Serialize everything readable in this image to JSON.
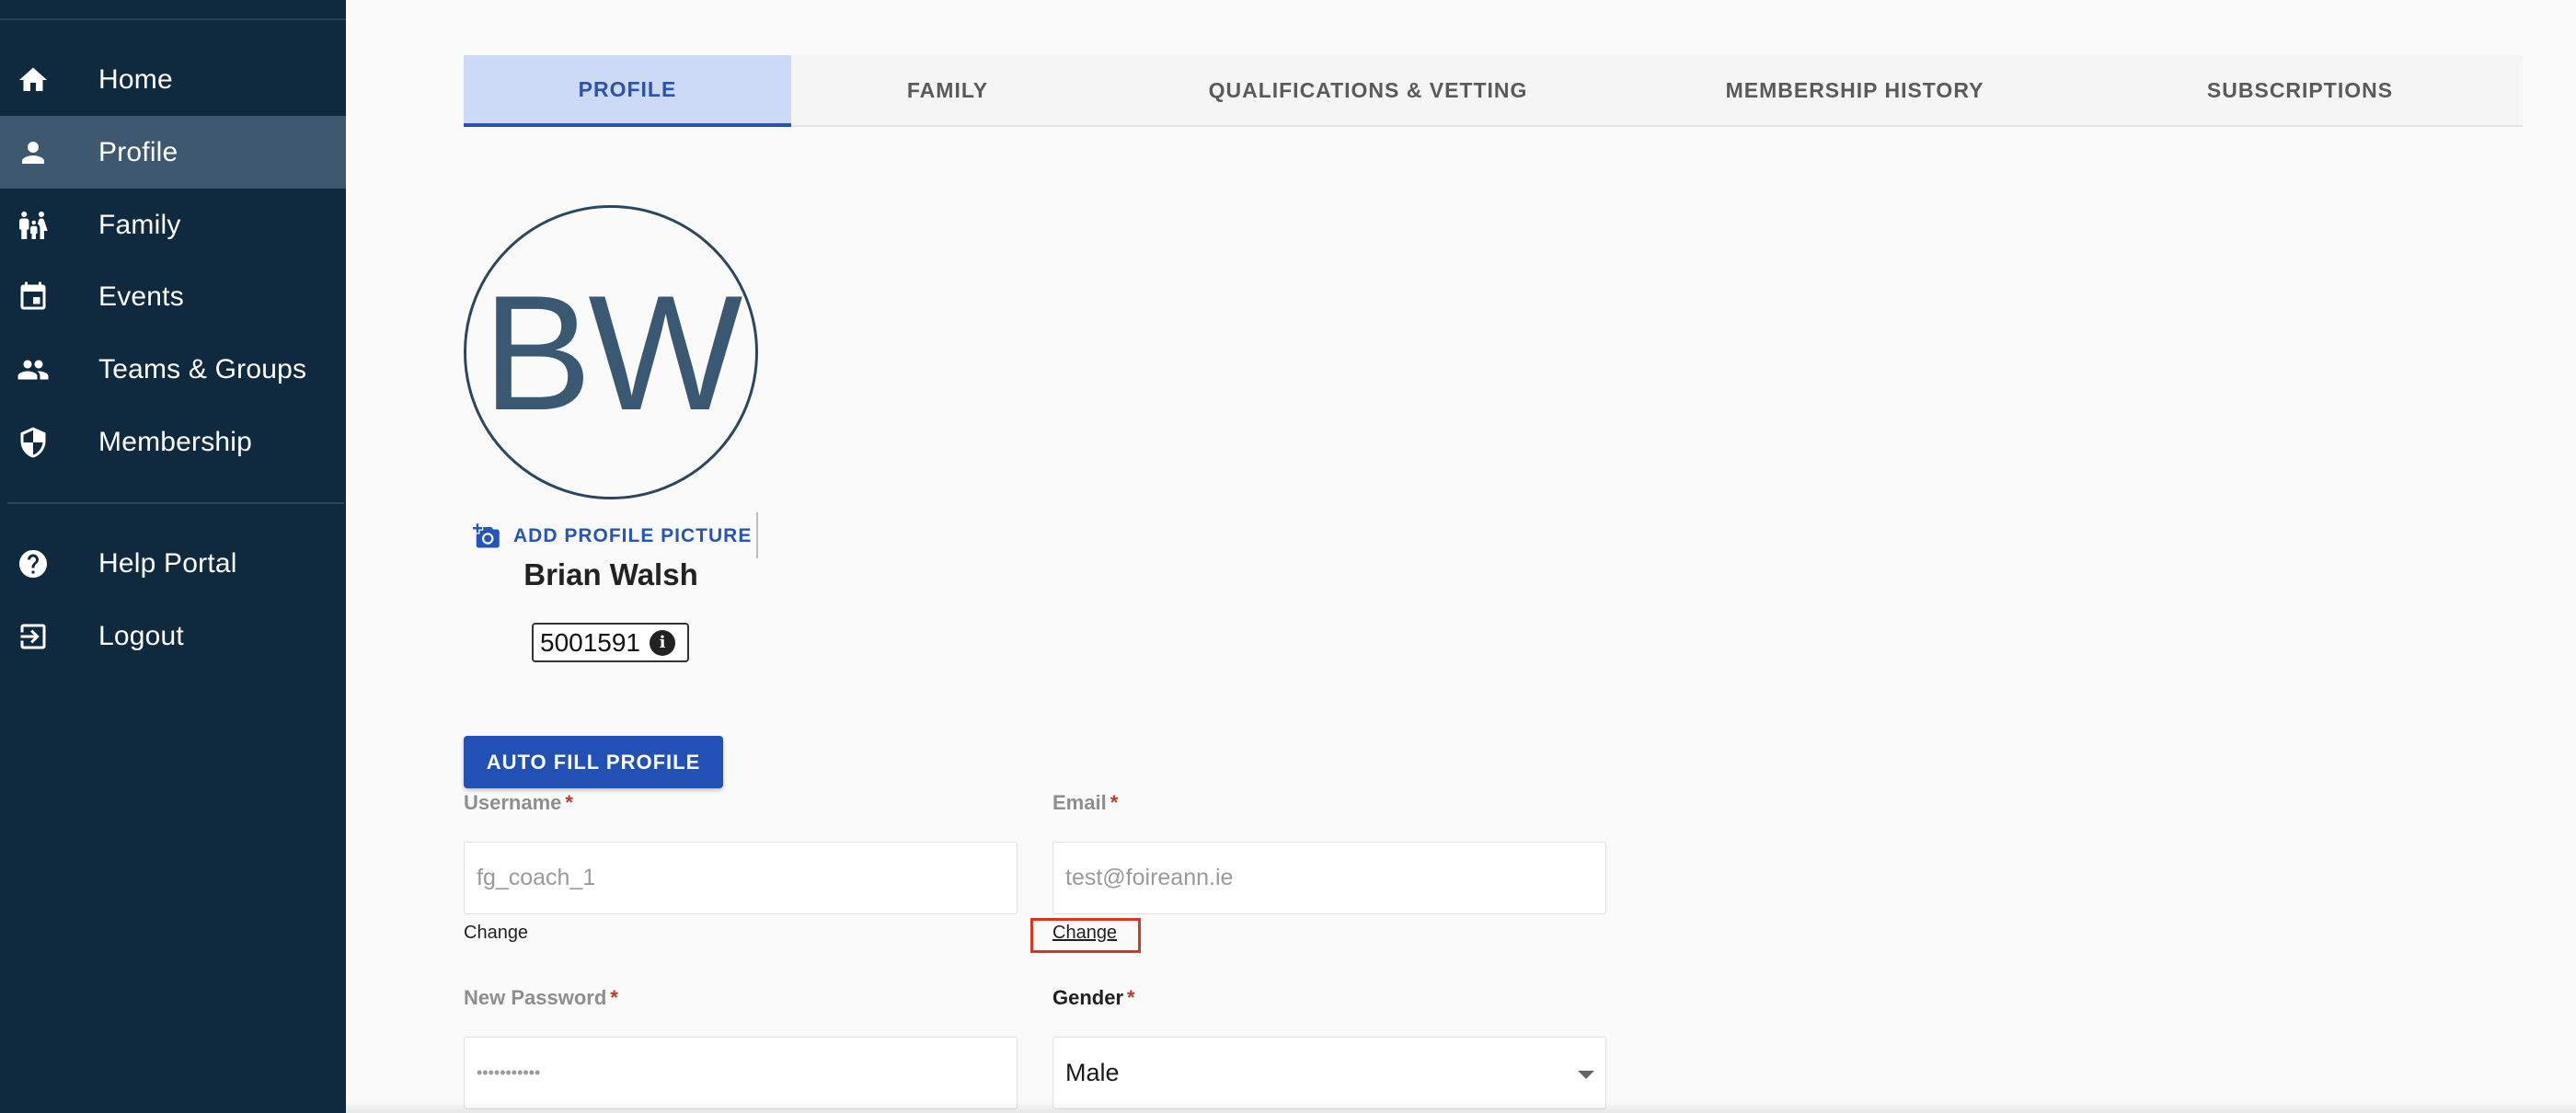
{
  "sidebar": {
    "items": [
      {
        "label": "Home",
        "icon": "home-icon"
      },
      {
        "label": "Profile",
        "icon": "person-icon",
        "active": true
      },
      {
        "label": "Family",
        "icon": "family-icon"
      },
      {
        "label": "Events",
        "icon": "calendar-icon"
      },
      {
        "label": "Teams & Groups",
        "icon": "group-icon"
      },
      {
        "label": "Membership",
        "icon": "shield-icon"
      }
    ],
    "footer_items": [
      {
        "label": "Help Portal",
        "icon": "help-icon"
      },
      {
        "label": "Logout",
        "icon": "logout-icon"
      }
    ]
  },
  "tabs": [
    {
      "label": "PROFILE",
      "active": true
    },
    {
      "label": "FAMILY"
    },
    {
      "label": "QUALIFICATIONS & VETTING"
    },
    {
      "label": "MEMBERSHIP HISTORY"
    },
    {
      "label": "SUBSCRIPTIONS"
    }
  ],
  "profile": {
    "initials": "BW",
    "add_picture_label": "ADD PROFILE PICTURE",
    "name": "Brian Walsh",
    "member_id": "5001591",
    "info_glyph": "i",
    "autofill_label": "AUTO FILL PROFILE"
  },
  "form": {
    "username": {
      "label": "Username",
      "required_mark": "*",
      "value": "fg_coach_1",
      "change_label": "Change"
    },
    "email": {
      "label": "Email",
      "required_mark": "*",
      "value": "test@foireann.ie",
      "change_label": "Change"
    },
    "new_password": {
      "label": "New Password",
      "required_mark": "*",
      "value": "•••••••••••"
    },
    "gender": {
      "label": "Gender",
      "required_mark": "*",
      "value": "Male"
    }
  },
  "colors": {
    "sidebar_bg": "#0f2a3f",
    "sidebar_active": "#3e5870",
    "accent": "#2350b5",
    "tab_active_bg": "#ccdaf6",
    "highlight": "#d9361f"
  }
}
